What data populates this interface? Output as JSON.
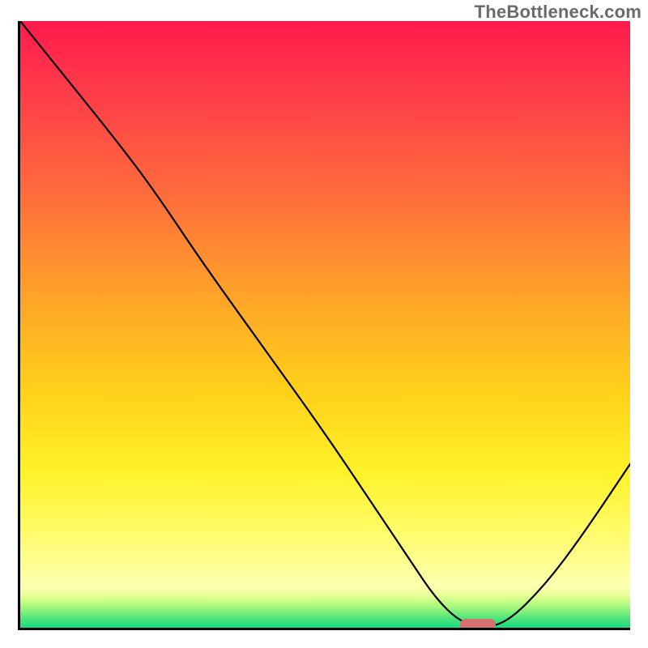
{
  "watermark": "TheBottleneck.com",
  "chart_data": {
    "type": "line",
    "title": "",
    "xlabel": "",
    "ylabel": "",
    "xlim": [
      0,
      100
    ],
    "ylim": [
      0,
      100
    ],
    "grid": false,
    "legend": false,
    "series": [
      {
        "name": "bottleneck-curve",
        "x": [
          0,
          8,
          16,
          22,
          30,
          40,
          50,
          58,
          64,
          68,
          72,
          76,
          80,
          86,
          92,
          100
        ],
        "y": [
          100,
          90,
          80,
          72,
          60,
          46,
          32,
          20,
          11,
          5,
          1,
          0,
          1,
          7,
          15,
          27
        ]
      }
    ],
    "optimum_marker": {
      "x": 75,
      "y": 0.6
    },
    "gradient_stops": {
      "top": "#ff1a4d",
      "mid1": "#ffa12a",
      "mid2": "#fff22a",
      "band_hi": "#fdffb0",
      "band_lo": "#17d97e"
    }
  }
}
